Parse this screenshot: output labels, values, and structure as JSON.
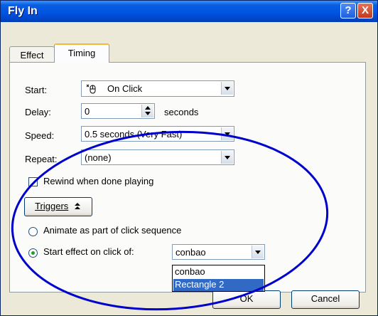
{
  "window": {
    "title": "Fly In",
    "help_label": "?",
    "close_label": "X"
  },
  "tabs": [
    {
      "label": "Effect"
    },
    {
      "label": "Timing"
    }
  ],
  "timing": {
    "start_label": "Start:",
    "start_value": "On Click",
    "delay_label": "Delay:",
    "delay_value": "0",
    "delay_unit": "seconds",
    "speed_label": "Speed:",
    "speed_value": "0.5 seconds (Very Fast)",
    "repeat_label": "Repeat:",
    "repeat_value": "(none)",
    "rewind_label": "Rewind when done playing",
    "triggers_label": "Triggers",
    "triggers_icon": "double-chevron-up-icon",
    "radio_animate_label": "Animate as part of click sequence",
    "radio_start_label": "Start effect on click of:",
    "trigger_object_value": "conbao",
    "dropdown_options": [
      "conbao",
      "Rectangle 2"
    ],
    "dropdown_selected": "Rectangle 2"
  },
  "buttons": {
    "ok_label": "OK",
    "cancel_label": "Cancel"
  },
  "annotation_color": "#0000cc"
}
